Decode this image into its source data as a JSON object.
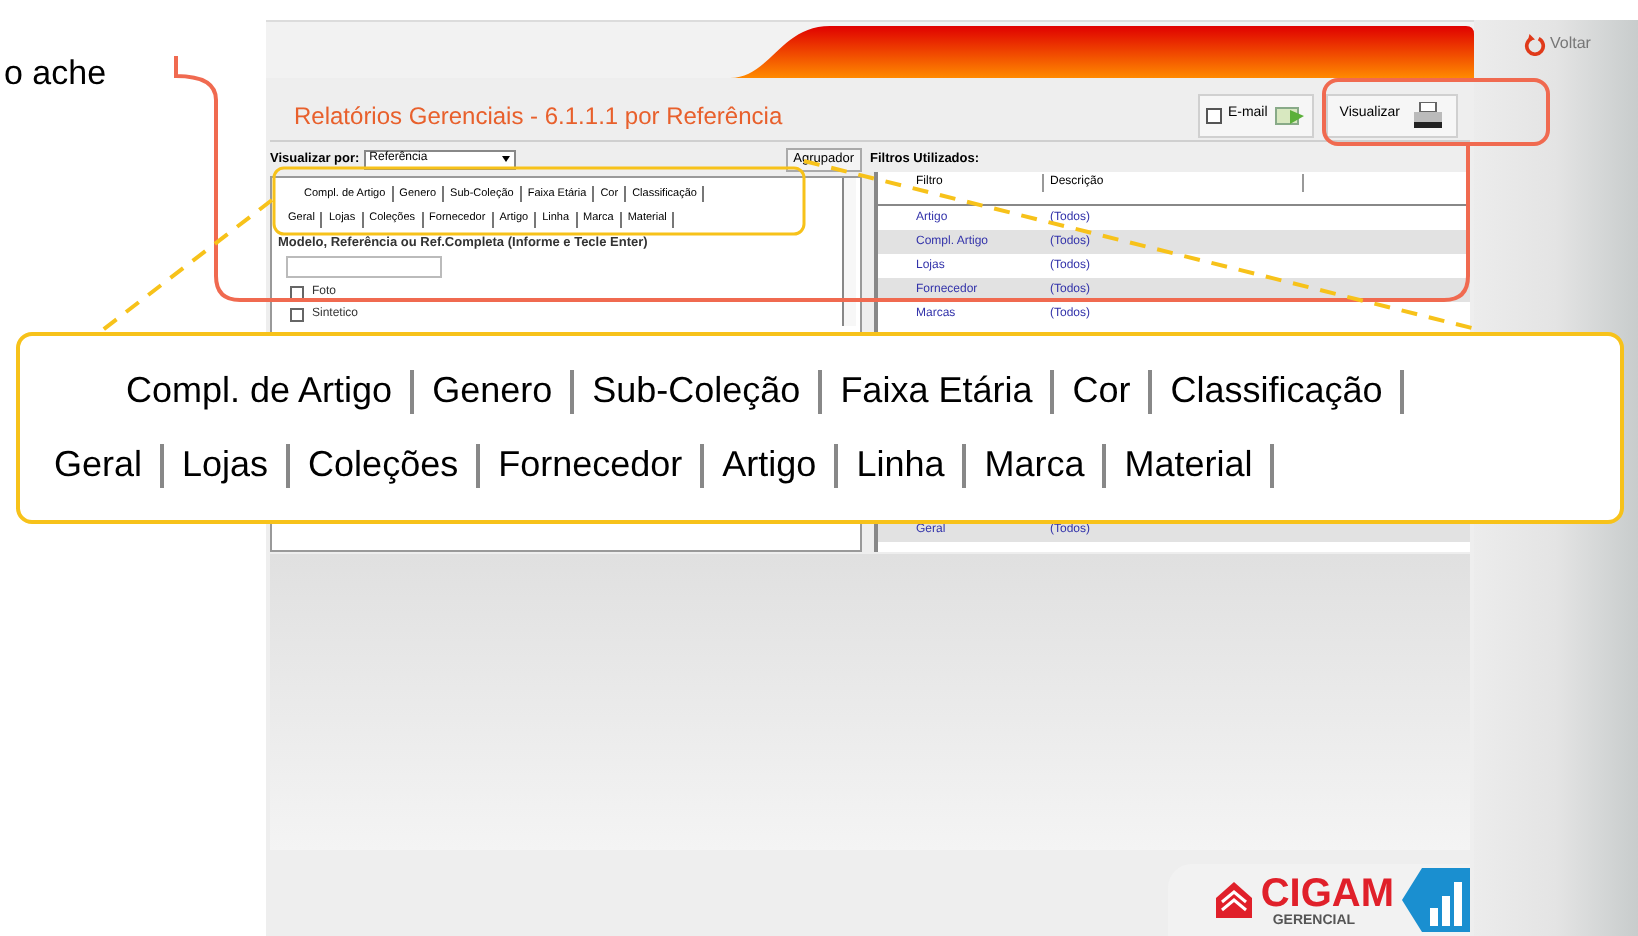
{
  "caption_fragment": "o ache",
  "header": {
    "back_label": "Voltar"
  },
  "report": {
    "title": "Relatórios Gerenciais - 6.1.1.1 por Referência",
    "view_by_label": "Visualizar por:",
    "view_by_value": "Referência",
    "group_button": "Agrupador",
    "email": {
      "label": "E-mail",
      "checked": false
    },
    "preview_button": "Visualizar",
    "tabs_row_1": [
      "Compl. de Artigo",
      "Genero",
      "Sub-Coleção",
      "Faixa Etária",
      "Cor",
      "Classificação"
    ],
    "tabs_row_2": [
      "Geral",
      "Lojas",
      "Coleções",
      "Fornecedor",
      "Artigo",
      "Linha",
      "Marca",
      "Material"
    ],
    "model_field_label": "Modelo, Referência ou Ref.Completa (Informe e Tecle Enter)",
    "options": [
      {
        "label": "Foto",
        "checked": false
      },
      {
        "label": "Sintetico",
        "checked": false
      }
    ],
    "filters": {
      "title": "Filtros Utilizados:",
      "columns": [
        "Filtro",
        "Descrição"
      ],
      "rows": [
        {
          "filter": "Artigo",
          "description": "(Todos)"
        },
        {
          "filter": "Compl. Artigo",
          "description": "(Todos)"
        },
        {
          "filter": "Lojas",
          "description": "(Todos)"
        },
        {
          "filter": "Fornecedor",
          "description": "(Todos)"
        },
        {
          "filter": "Marcas",
          "description": "(Todos)"
        }
      ],
      "last_row": {
        "filter": "Geral",
        "description": "(Todos)"
      }
    }
  },
  "callout": {
    "tabs_row_1": [
      "Compl. de Artigo",
      "Genero",
      "Sub-Coleção",
      "Faixa Etária",
      "Cor",
      "Classificação"
    ],
    "tabs_row_2": [
      "Geral",
      "Lojas",
      "Coleções",
      "Fornecedor",
      "Artigo",
      "Linha",
      "Marca",
      "Material"
    ]
  },
  "logo": {
    "name": "CIGAM",
    "subtitle": "GERENCIAL"
  }
}
